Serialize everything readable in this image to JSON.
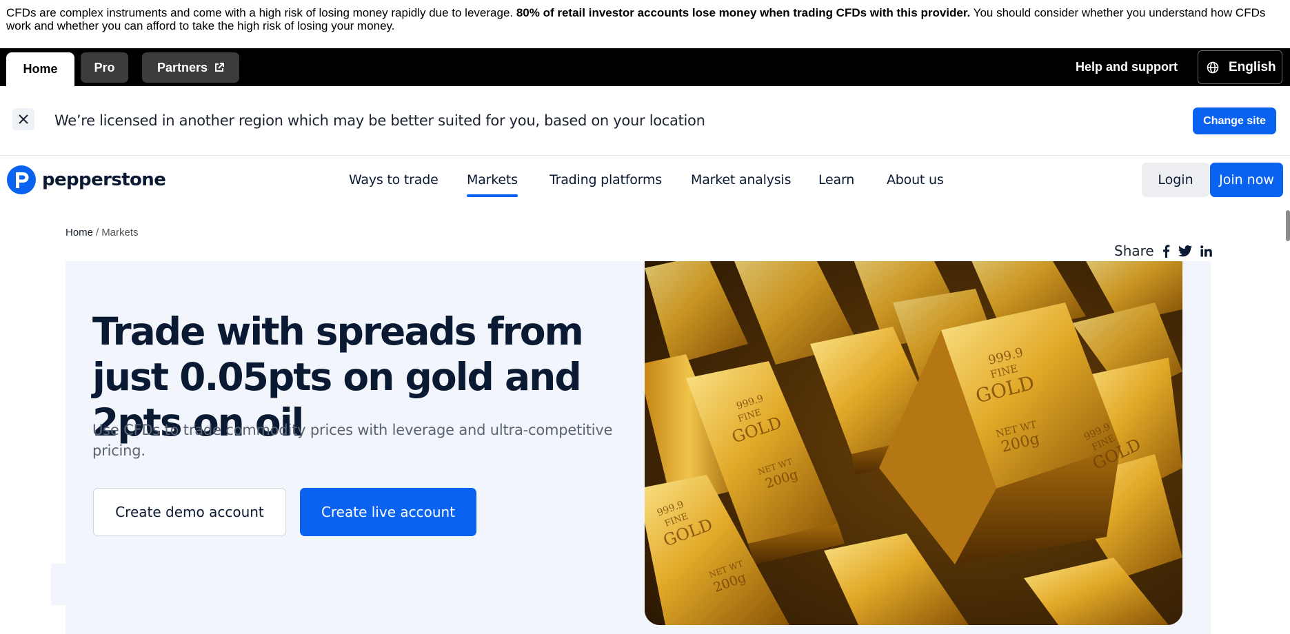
{
  "risk_warning": {
    "text_start": "CFDs are complex instruments and come with a high risk of losing money rapidly due to leverage. ",
    "text_bold": "80% of retail investor accounts lose money when trading CFDs with this provider.",
    "text_end": " You should consider whether you understand how CFDs work and whether you can afford to take the high risk of losing your money."
  },
  "topbar": {
    "tabs": [
      {
        "label": "Home"
      },
      {
        "label": "Pro"
      },
      {
        "label": "Partners"
      }
    ],
    "help_label": "Help and support",
    "language_label": "English"
  },
  "region_banner": {
    "message": "We’re licensed in another region which may be better suited for you, based on your location",
    "change_site_label": "Change site"
  },
  "nav": {
    "logo_text": "pepperstone",
    "items": [
      {
        "label": "Ways to trade"
      },
      {
        "label": "Markets"
      },
      {
        "label": "Trading platforms"
      },
      {
        "label": "Market analysis"
      },
      {
        "label": "Learn"
      },
      {
        "label": "About us"
      }
    ],
    "login_label": "Login",
    "join_label": "Join now"
  },
  "breadcrumb": {
    "home": "Home",
    "separator": "/",
    "current": "Markets"
  },
  "share": {
    "label": "Share"
  },
  "hero": {
    "title": "Trade with spreads from just 0.05pts on gold and 2pts on oil",
    "subtitle": "Use CFDs to trade commodity prices with leverage and ultra-competitive pricing.",
    "demo_button": "Create demo account",
    "live_button": "Create live account"
  },
  "gold_bar_text": {
    "purity": "999.9",
    "fine": "FINE",
    "gold": "GOLD",
    "net_wt": "NET WT",
    "weight": "200g"
  },
  "colors": {
    "accent": "#0a62f0",
    "topbar": "#000000",
    "hero_bg": "#f2f5fb"
  }
}
